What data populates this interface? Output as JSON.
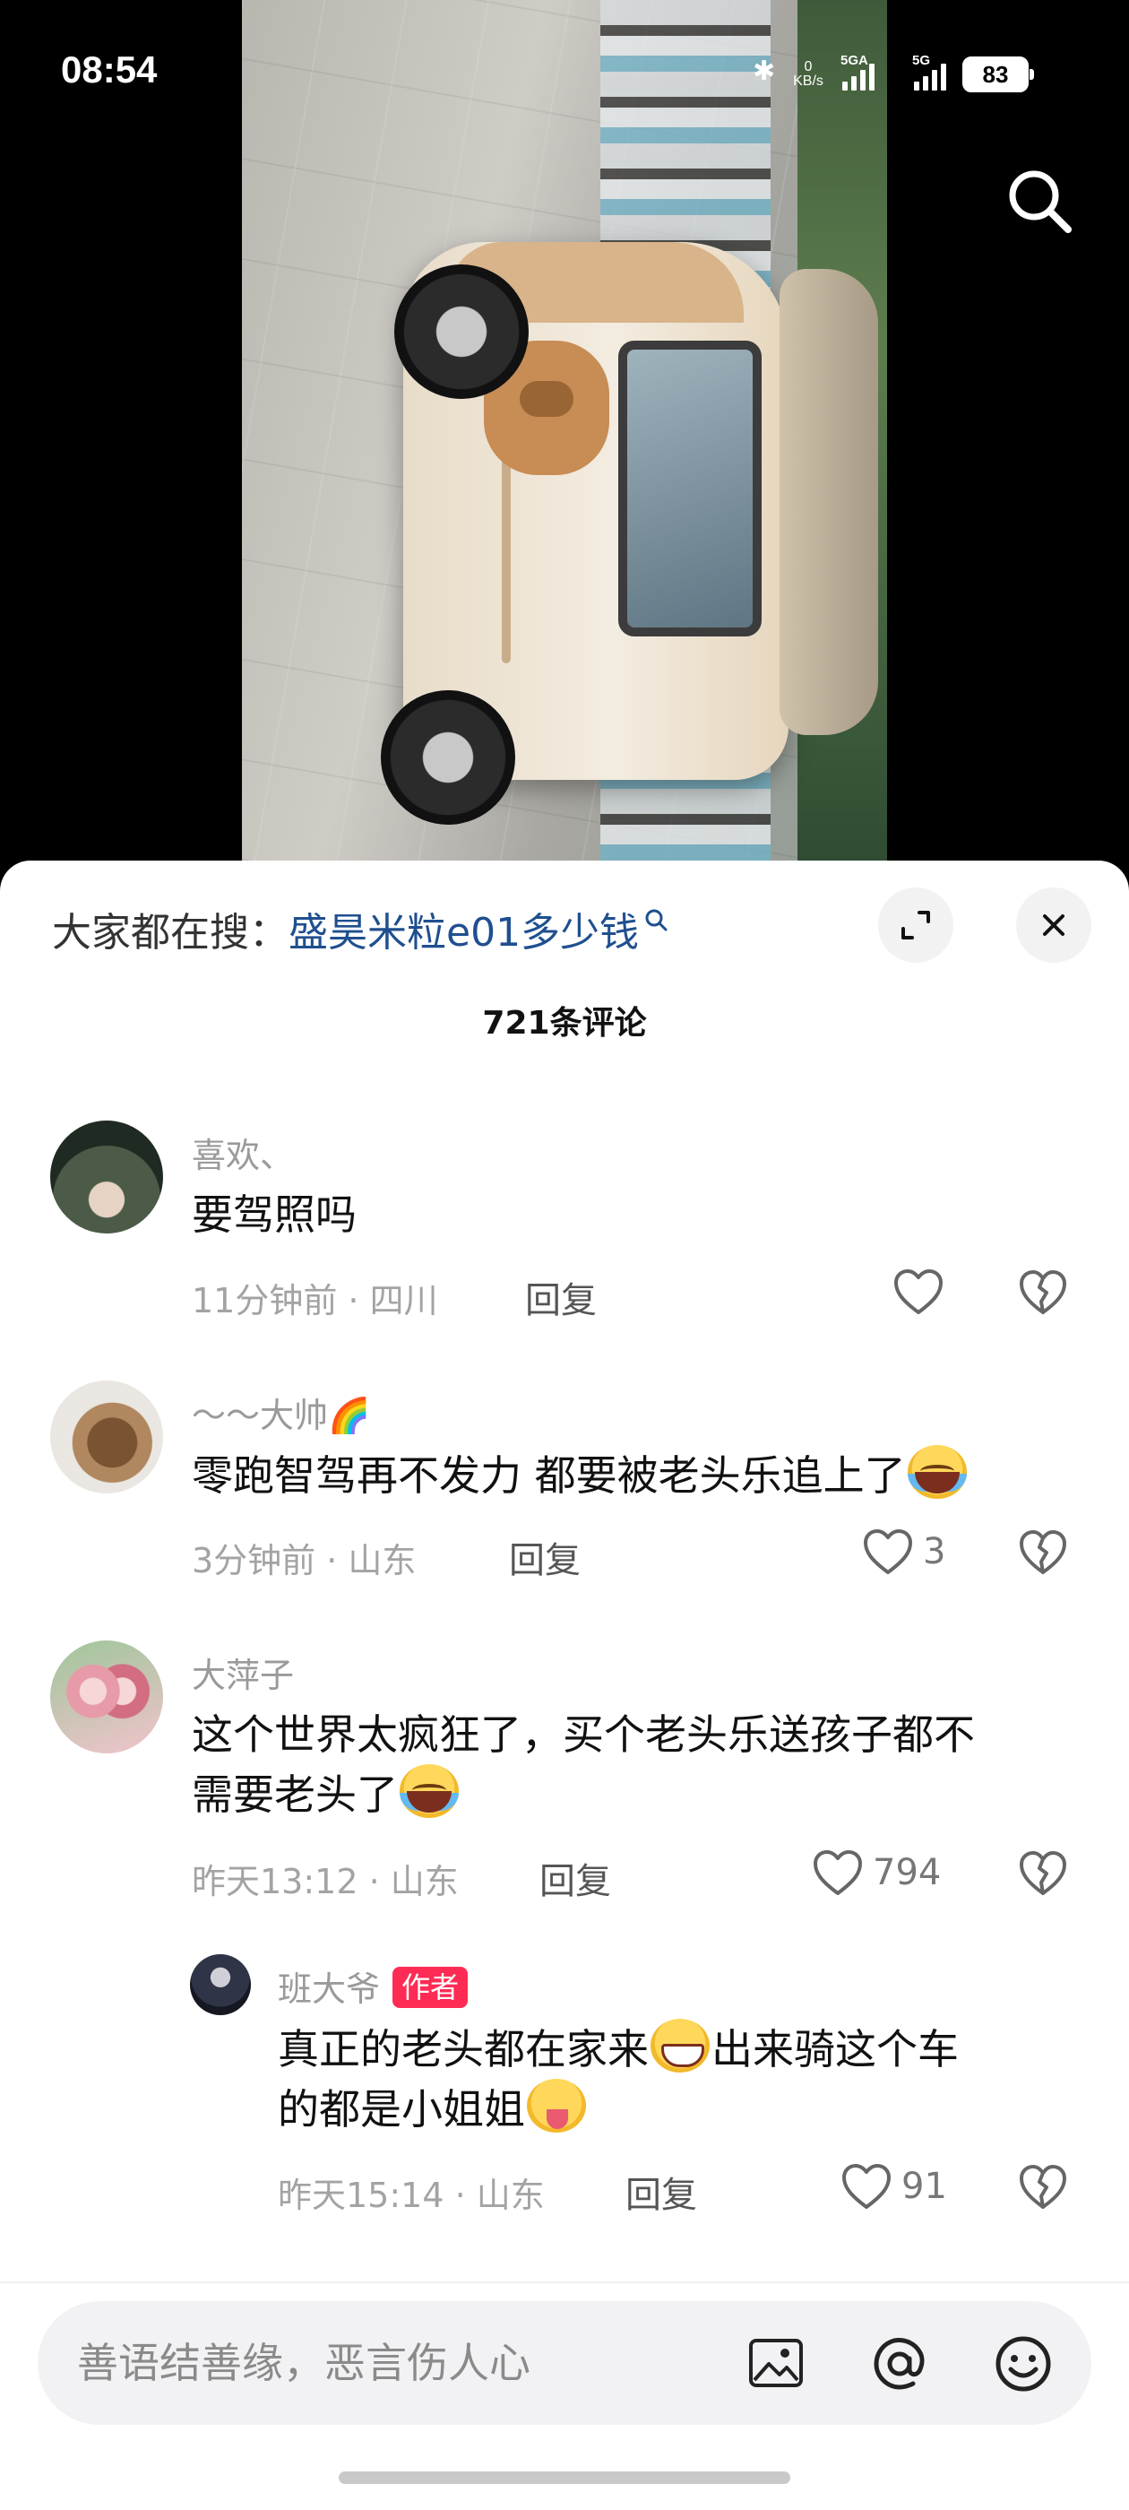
{
  "status_bar": {
    "time": "08:54",
    "speed_value": "0",
    "speed_unit": "KB/s",
    "signal1": "5GA",
    "signal2": "5G",
    "battery": "83"
  },
  "sheet": {
    "search_prefix": "大家都在搜：",
    "search_query": "盛昊米粒e01多少钱",
    "comment_count": "721条评论"
  },
  "comments": [
    {
      "name": "喜欢、",
      "text": "要驾照吗",
      "time_location": "11分钟前 · 四川",
      "reply": "回复",
      "likes": ""
    },
    {
      "name": "～～大帅🌈",
      "text": "零跑智驾再不发力 都要被老头乐追上了",
      "time_location": "3分钟前 · 山东",
      "reply": "回复",
      "likes": "3"
    },
    {
      "name": "大萍子",
      "text_line1": "这个世界太疯狂了，买个老头乐送孩子都不",
      "text_line2": "需要老头了",
      "time_location": "昨天13:12 · 山东",
      "reply": "回复",
      "likes": "794"
    },
    {
      "name": "班大爷",
      "tag": "作者",
      "text_line1a": "真正的老头都在家来",
      "text_line1b": "出来骑这个车",
      "text_line2": "的都是小姐姐",
      "time_location": "昨天15:14 · 山东",
      "reply": "回复",
      "likes": "91"
    }
  ],
  "input": {
    "placeholder": "善语结善缘，恶言伤人心"
  },
  "icons": {
    "search": "search-icon",
    "expand": "expand-icon",
    "close": "close-icon",
    "like": "heart-icon",
    "dislike": "broken-heart-icon",
    "image": "image-icon",
    "mention": "at-icon",
    "emoji": "emoji-icon"
  },
  "colors": {
    "accent": "#fe2c55",
    "query_link": "#1f4f8f"
  }
}
